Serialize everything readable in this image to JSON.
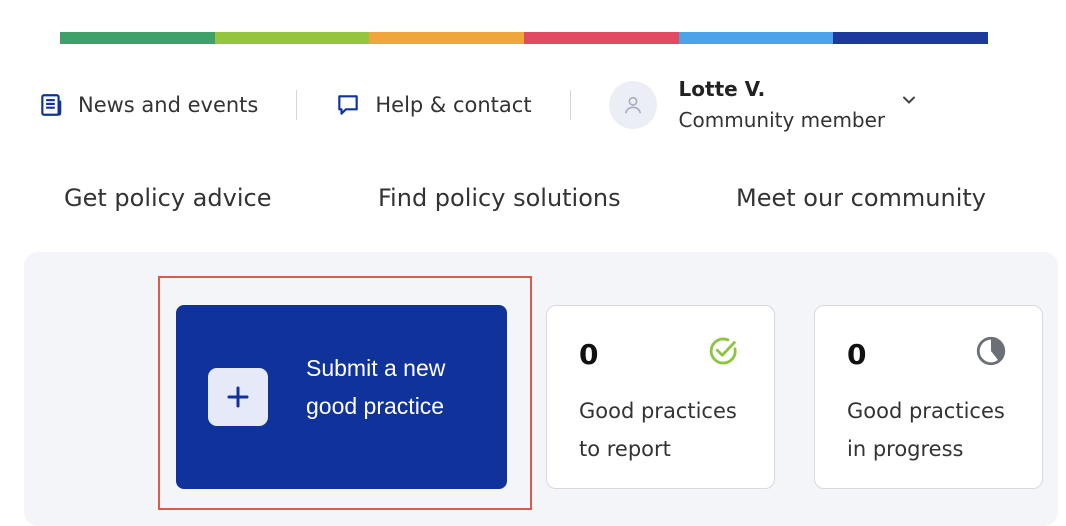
{
  "colors": {
    "brand_blue": "#10329b",
    "highlight_border": "#e0584a",
    "check_green": "#8cc63f",
    "icon_gray": "#6b6f76",
    "color_bar": [
      "#3fa06a",
      "#94c53e",
      "#efa63a",
      "#e14a60",
      "#4da3e8",
      "#1b3a9b"
    ]
  },
  "topbar": {
    "news_label": "News and events",
    "news_icon": "newspaper-icon",
    "help_label": "Help & contact",
    "help_icon": "chat-bubble-icon",
    "user": {
      "name": "Lotte V.",
      "role": "Community member",
      "avatar_icon": "user-icon",
      "menu_icon": "chevron-down-icon"
    }
  },
  "nav": {
    "items": [
      {
        "label": "Get policy advice"
      },
      {
        "label": "Find policy solutions"
      },
      {
        "label": "Meet our community"
      }
    ]
  },
  "dashboard": {
    "submit": {
      "line1": "Submit a new",
      "line2": "good practice",
      "icon": "plus-icon"
    },
    "stats": [
      {
        "value": "0",
        "line1": "Good practices",
        "line2": "to report",
        "icon": "check-circle-icon"
      },
      {
        "value": "0",
        "line1": "Good practices",
        "line2": "in progress",
        "icon": "pie-progress-icon"
      }
    ]
  }
}
